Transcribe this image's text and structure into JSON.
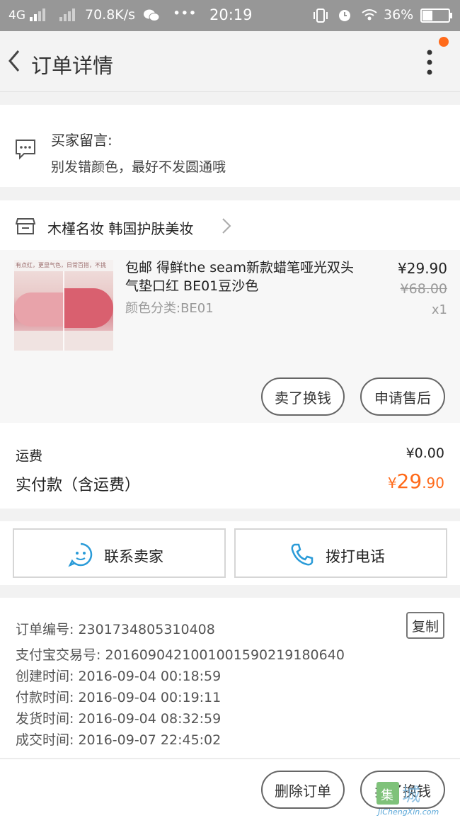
{
  "status_bar": {
    "network": "4G",
    "speed": "70.8K/s",
    "wechat_icon": "wechat-icon",
    "dots": "•••",
    "time": "20:19",
    "battery": "36%"
  },
  "header": {
    "title": "订单详情",
    "notification_color": "#ff6a1a"
  },
  "buyer_message": {
    "label": "买家留言:",
    "text": "别发错颜色，最好不发圆通哦"
  },
  "shop": {
    "name": "木槿名妆 韩国护肤美妆"
  },
  "item": {
    "title": "包邮 得鲜the seam新款蜡笔哑光双头气垫口红 BE01豆沙色",
    "spec": "颜色分类:BE01",
    "price": "¥29.90",
    "original_price": "¥68.00",
    "quantity": "x1",
    "thumbnail_caption": "有点红，更显气色，日常百搭，不挑"
  },
  "item_actions": {
    "sell": "卖了换钱",
    "after_sale": "申请售后"
  },
  "payment": {
    "shipping_label": "运费",
    "shipping_value": "¥0.00",
    "total_label": "实付款（含运费）",
    "total_symbol": "¥",
    "total_int": "29",
    "total_dec": ".90",
    "accent_color": "#ff6a1a"
  },
  "contact": {
    "seller": "联系卖家",
    "phone": "拨打电话",
    "icon_color": "#2a9bd8"
  },
  "order_info": {
    "order_no": "订单编号: 2301734805310408",
    "alipay_no": "支付宝交易号: 2016090421001001590219180640",
    "created": "创建时间: 2016-09-04 00:18:59",
    "paid": "付款时间: 2016-09-04 00:19:11",
    "shipped": "发货时间: 2016-09-04 08:32:59",
    "completed": "成交时间: 2016-09-07 22:45:02",
    "copy": "复制"
  },
  "footer": {
    "delete": "删除订单",
    "sell": "卖了换钱"
  },
  "watermark": {
    "glyph": "集",
    "text": "城",
    "url": "JiChengXin.com"
  }
}
